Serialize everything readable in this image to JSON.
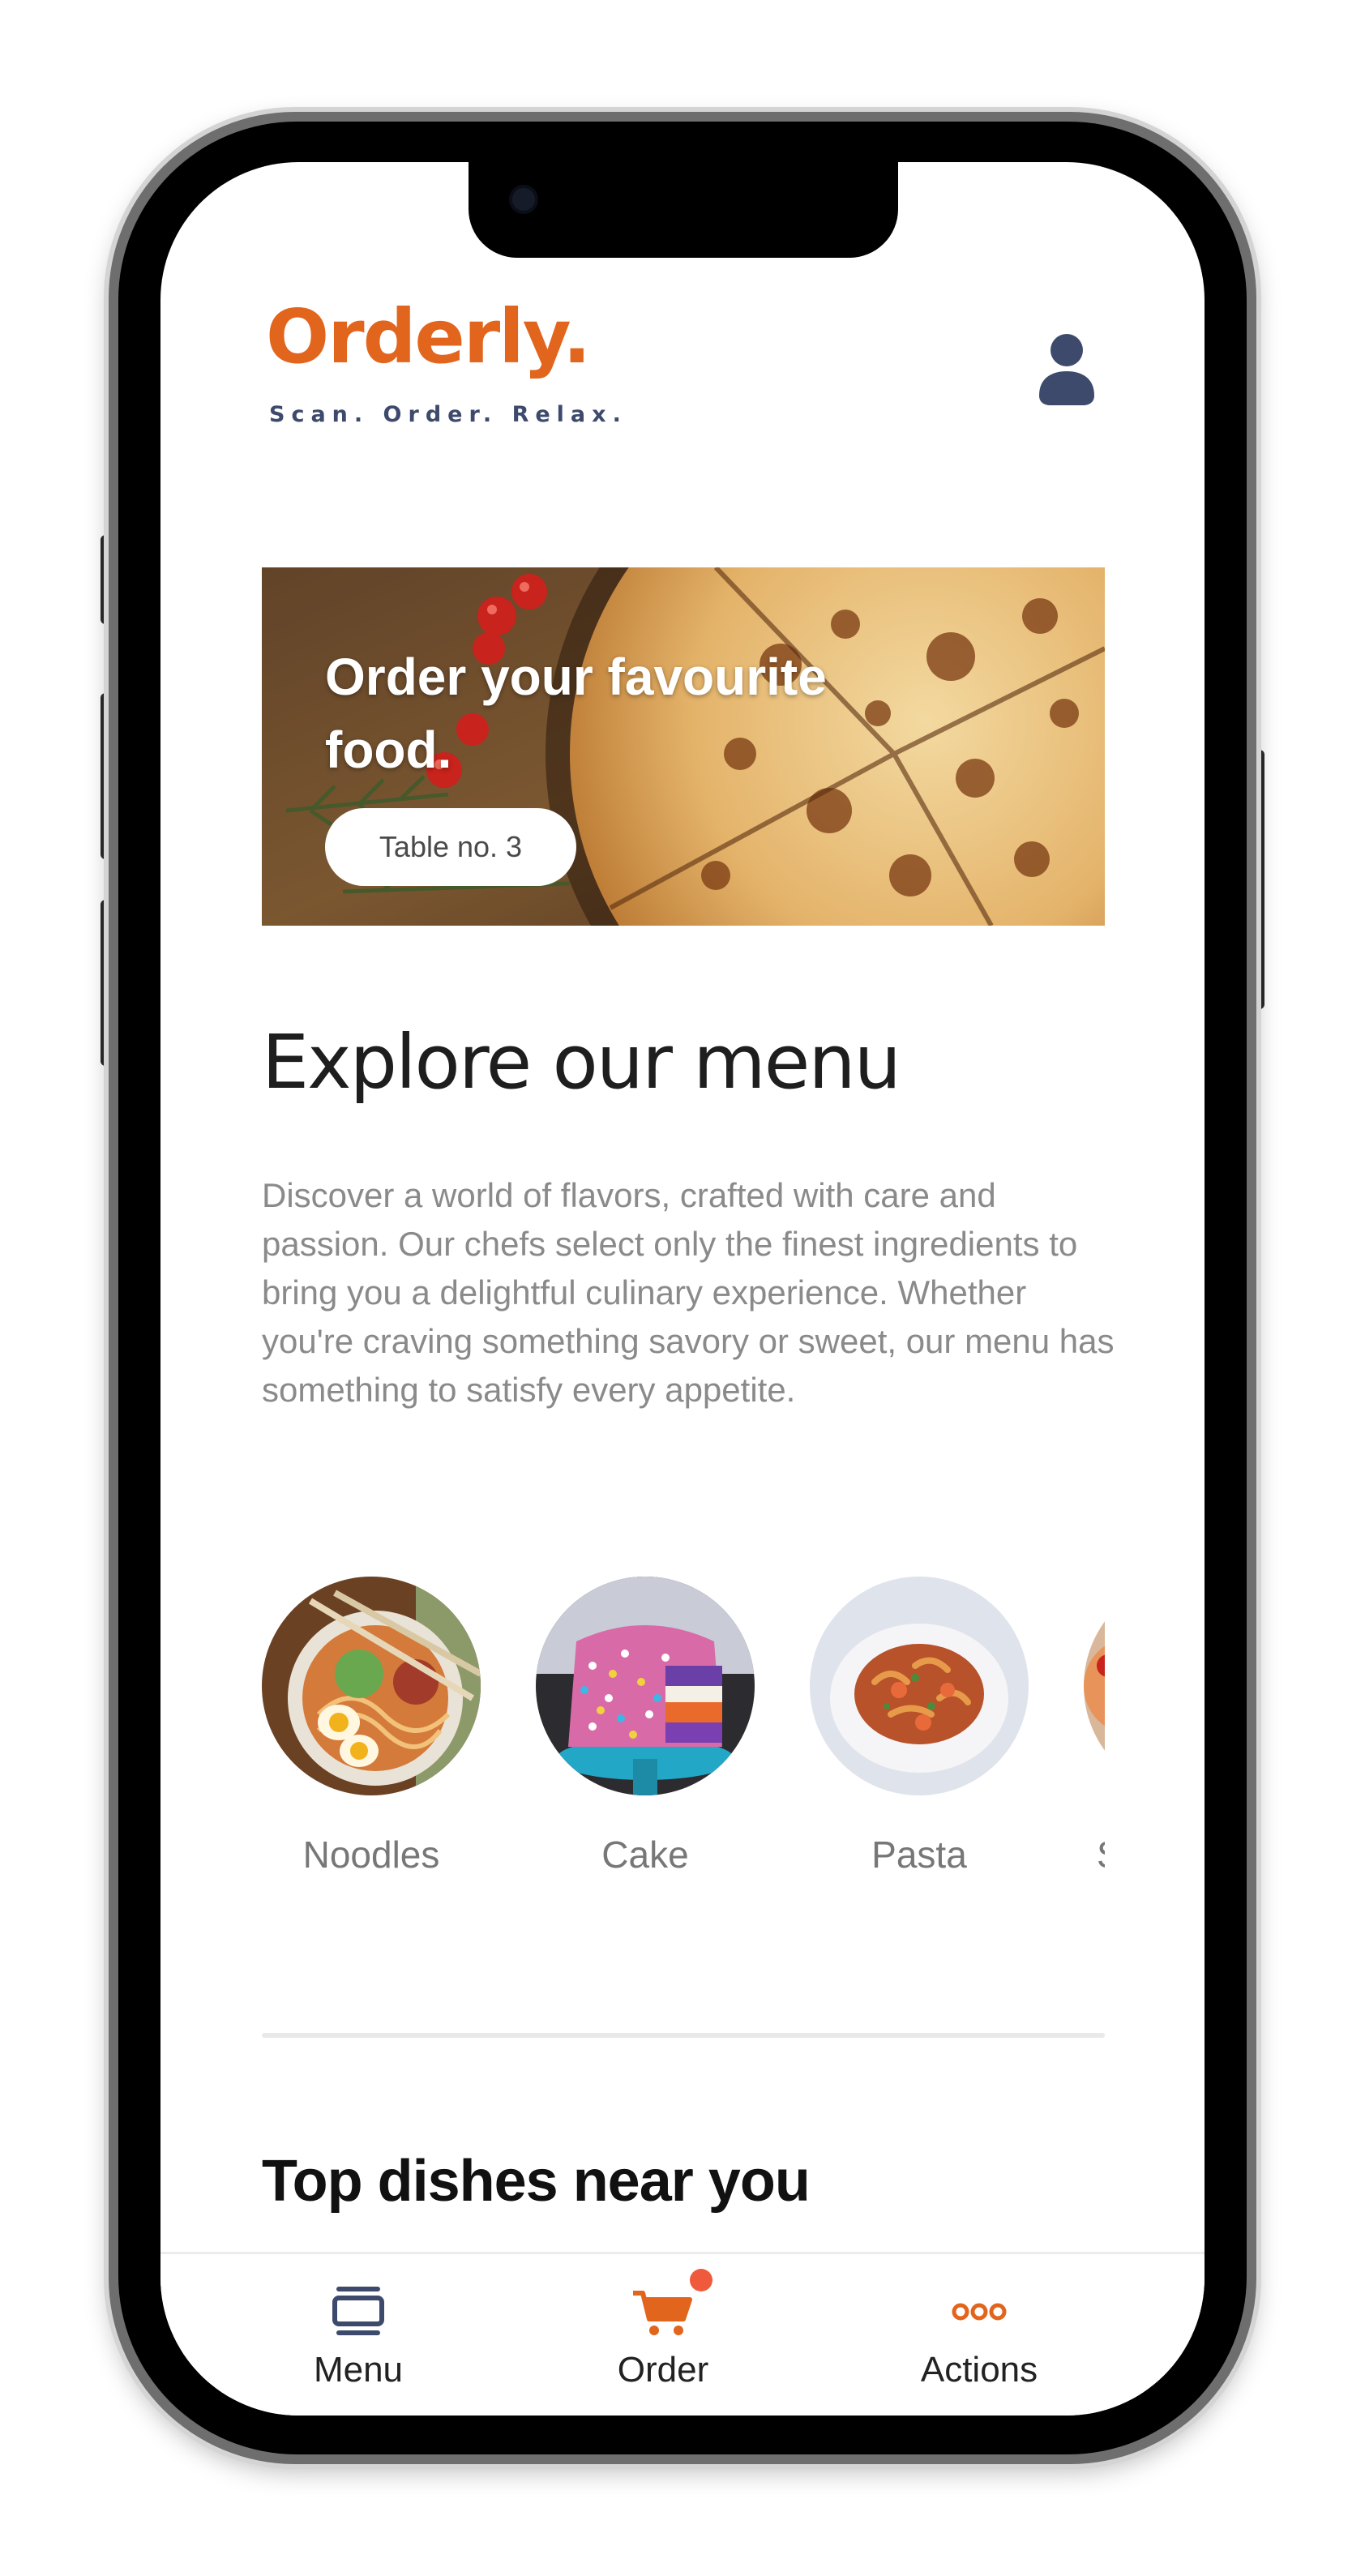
{
  "app": {
    "logo": "Orderly.",
    "tagline": "Scan. Order. Relax."
  },
  "banner": {
    "title": "Order your favourite food.",
    "table_label": "Table no. 3"
  },
  "menu_section": {
    "title": "Explore our menu",
    "description": "Discover a world of flavors, crafted with care and passion. Our chefs select only the finest ingredients to bring you a delightful culinary experience. Whether you're craving something savory or sweet, our menu has something to satisfy every appetite."
  },
  "categories": [
    {
      "label": "Noodles"
    },
    {
      "label": "Cake"
    },
    {
      "label": "Pasta"
    },
    {
      "label": "S"
    }
  ],
  "top_dishes": {
    "title": "Top dishes near you"
  },
  "bottom_nav": {
    "items": [
      {
        "label": "Menu",
        "icon": "menu-cards-icon"
      },
      {
        "label": "Order",
        "icon": "cart-icon",
        "has_badge": true
      },
      {
        "label": "Actions",
        "icon": "more-dots-icon"
      }
    ]
  },
  "colors": {
    "brand": "#e2651d",
    "tagline": "#3d4a6b",
    "badge": "#f05a3c",
    "text_muted": "#8a8a8a"
  }
}
